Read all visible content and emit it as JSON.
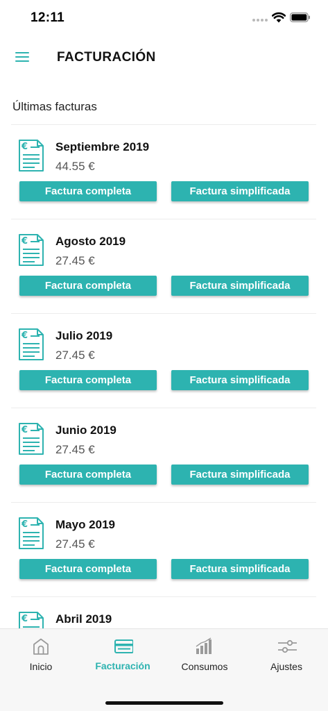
{
  "status_bar": {
    "time": "12:11"
  },
  "header": {
    "title": "FACTURACIÓN"
  },
  "section": {
    "title": "Últimas facturas"
  },
  "invoices": [
    {
      "month": "Septiembre 2019",
      "amount": "44.55 €",
      "full_label": "Factura completa",
      "simple_label": "Factura simplificada"
    },
    {
      "month": "Agosto 2019",
      "amount": "27.45 €",
      "full_label": "Factura completa",
      "simple_label": "Factura simplificada"
    },
    {
      "month": "Julio 2019",
      "amount": "27.45 €",
      "full_label": "Factura completa",
      "simple_label": "Factura simplificada"
    },
    {
      "month": "Junio 2019",
      "amount": "27.45 €",
      "full_label": "Factura completa",
      "simple_label": "Factura simplificada"
    },
    {
      "month": "Mayo 2019",
      "amount": "27.45 €",
      "full_label": "Factura completa",
      "simple_label": "Factura simplificada"
    },
    {
      "month": "Abril 2019",
      "amount": "",
      "full_label": "",
      "simple_label": ""
    }
  ],
  "tabs": [
    {
      "label": "Inicio",
      "icon": "home-icon",
      "active": false
    },
    {
      "label": "Facturación",
      "icon": "card-icon",
      "active": true
    },
    {
      "label": "Consumos",
      "icon": "bar-chart-icon",
      "active": false
    },
    {
      "label": "Ajustes",
      "icon": "sliders-icon",
      "active": false
    }
  ],
  "colors": {
    "accent": "#2db3b0",
    "text": "#111111",
    "muted": "#555555",
    "tab_bg": "#f7f7f7"
  }
}
